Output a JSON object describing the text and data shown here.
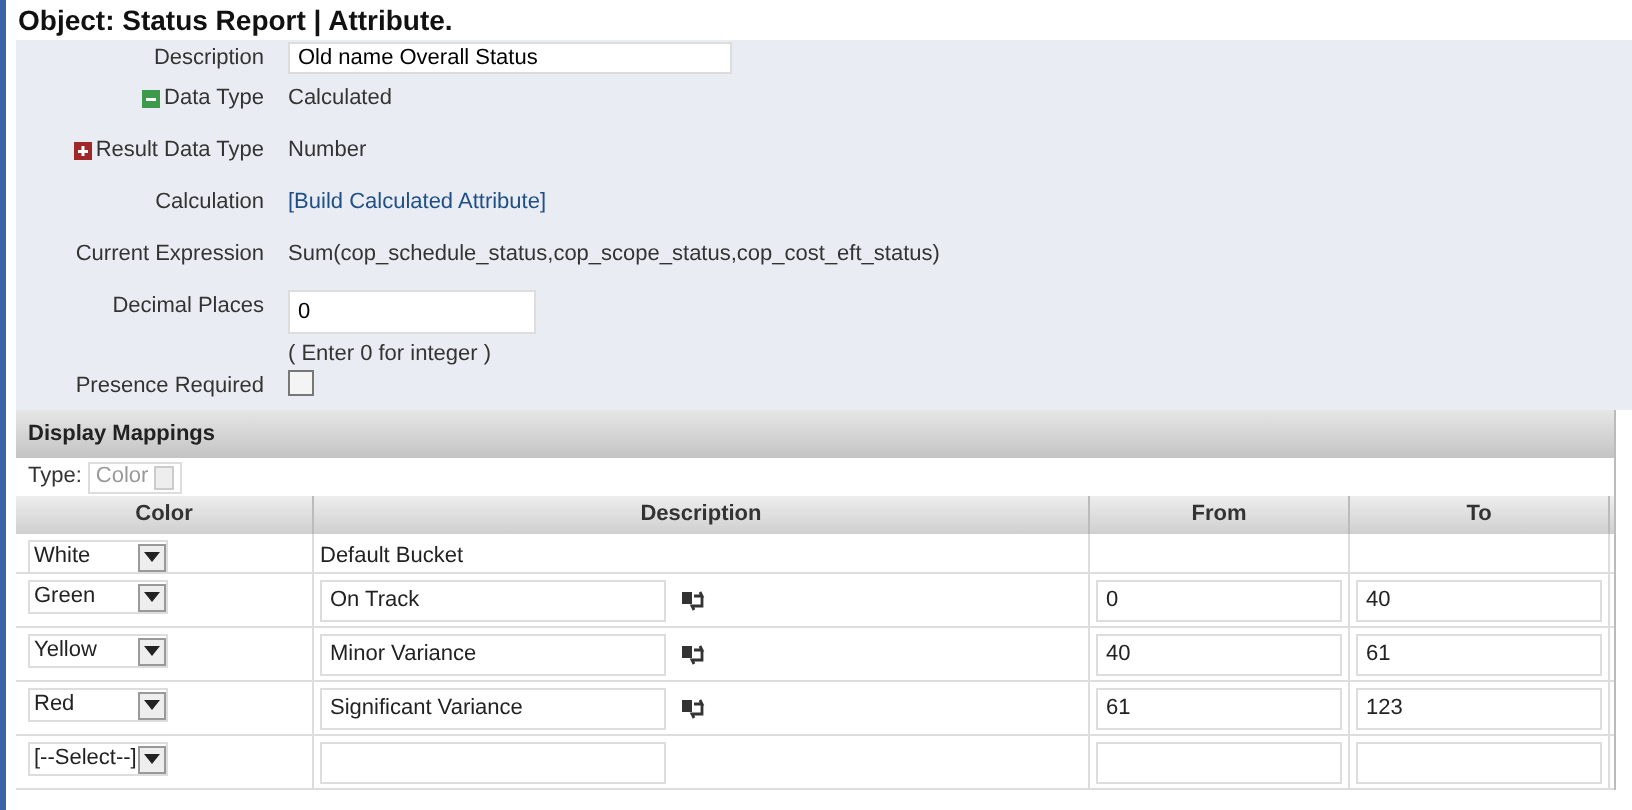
{
  "title": "Object: Status Report | Attribute.",
  "form": [
    {
      "kind": "field",
      "label": "Description",
      "value": "Old name Overall Status"
    },
    {
      "kind": "text",
      "label": "Data Type",
      "value": "Calculated",
      "expanded": true
    },
    {
      "kind": "text",
      "label": "Result Data Type",
      "value": "Number",
      "expanded": false
    },
    {
      "kind": "link",
      "label": "Calculation",
      "value": "[Build Calculated Attribute]"
    },
    {
      "kind": "text",
      "label": "Current Expression",
      "value": "Sum(cop_schedule_status,cop_scope_status,cop_cost_eft_status)"
    },
    {
      "kind": "field",
      "label": "Decimal Places",
      "value": "0",
      "hint": "( Enter 0 for integer )"
    },
    {
      "kind": "checkbox",
      "label": "Presence Required",
      "checked": false
    }
  ],
  "mappings": {
    "title": "Display Mappings",
    "type_label": "Type:",
    "type_value": "Color",
    "columns": [
      "Color",
      "Description",
      "From",
      "To"
    ],
    "rows": [
      {
        "kind": "default",
        "color_name": "White",
        "description": "Default Bucket"
      },
      {
        "kind": "range",
        "color_name": "Green",
        "description": "On Track",
        "from": "0",
        "to": "40"
      },
      {
        "kind": "range",
        "color_name": "Yellow",
        "description": "Minor Variance",
        "from": "40",
        "to": "61"
      },
      {
        "kind": "range",
        "color_name": "Red",
        "description": "Significant Variance",
        "from": "61",
        "to": "123"
      },
      {
        "kind": "new",
        "color_name": "[--Select--]"
      }
    ]
  }
}
